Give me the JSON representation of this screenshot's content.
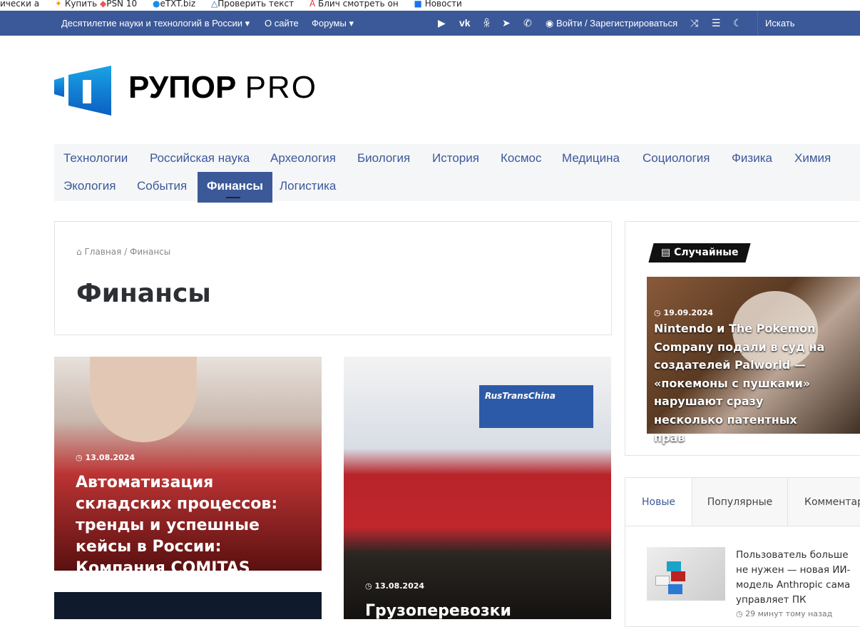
{
  "bookmarks": [
    "ически а",
    "Купить",
    "PSN 10",
    "eTXT.biz",
    "Проверить текст",
    "Блич смотреть он",
    "Новости"
  ],
  "topbar": {
    "menu": [
      "Десятилетие науки и технологий в России",
      "О сайте",
      "Форумы"
    ],
    "login": "Войти / Зарегистрироваться",
    "search": "Искать",
    "icons": [
      "youtube-icon",
      "vk-icon",
      "odnoklassniki-icon",
      "telegram-icon",
      "whatsapp-icon",
      "user-icon",
      "shuffle-icon",
      "menu-icon",
      "moon-icon"
    ]
  },
  "logo": {
    "bold": "РУПОР",
    "light": "PRO"
  },
  "nav": [
    "Технологии",
    "Российская наука",
    "Археология",
    "Биология",
    "История",
    "Космос",
    "Медицина",
    "Социология",
    "Физика",
    "Химия",
    "Экология",
    "События",
    "Финансы",
    "Логистика"
  ],
  "breadcrumb": {
    "home": "Главная",
    "sep": "/",
    "current": "Финансы"
  },
  "page_title": "Финансы",
  "articles": [
    {
      "date": "13.08.2024",
      "title": "Автоматизация складских процессов: тренды и успешные кейсы в России: Компания COMITAS"
    },
    {
      "date": "13.08.2024",
      "title": "Грузоперевозки"
    }
  ],
  "sidebar": {
    "random_heading": "Случайные",
    "random": {
      "date": "19.09.2024",
      "title": "Nintendo и The Pokemon Company подали в суд на создателей Palworld — «покемоны с пушками» нарушают сразу несколько патентных прав"
    },
    "tabs": [
      "Новые",
      "Популярные",
      "Комментарии"
    ],
    "latest": [
      {
        "title": "Пользователь больше не нужен — новая ИИ-модель Anthropic сама управляет ПК",
        "time": "29 минут тому назад"
      }
    ]
  },
  "colors": {
    "brand": "#3b5998"
  }
}
